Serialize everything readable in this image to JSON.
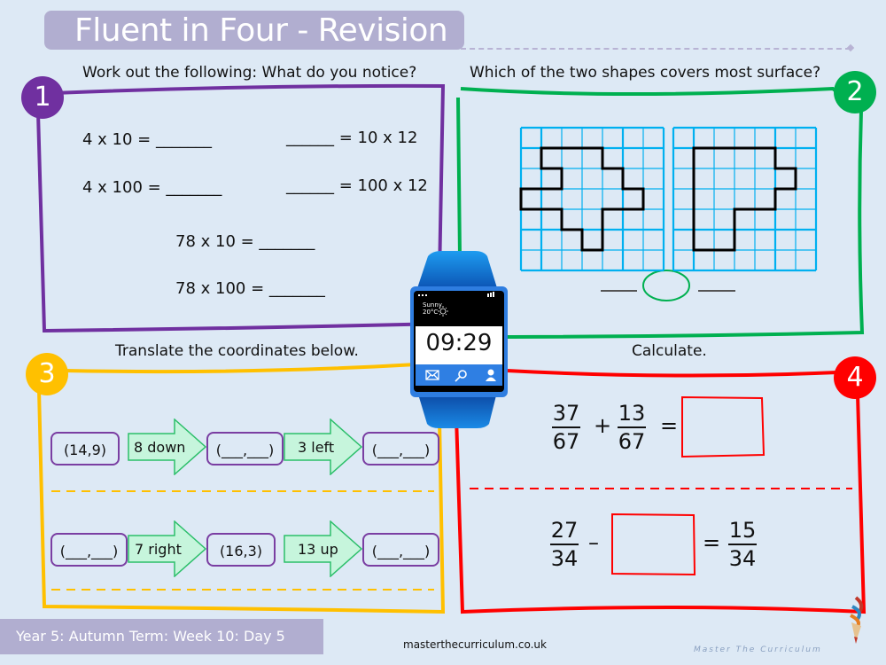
{
  "header": {
    "title": "Fluent in Four - Revision"
  },
  "footer": {
    "label": "Year 5: Autumn Term: Week 10: Day 5",
    "website": "masterthecurriculum.co.uk",
    "brand": "Master The Curriculum"
  },
  "colors": {
    "q1": "#7030a0",
    "q2": "#00b050",
    "q3": "#ffc000",
    "q4": "#ff0000",
    "grid": "#00b0f0",
    "arrow_fill": "#c6f5dc",
    "arrow_stroke": "#2cbf6a",
    "coord_border": "#7a3ea2",
    "banner": "#b1aed0"
  },
  "q1": {
    "number": "1",
    "prompt": "Work out the following: What do you notice?",
    "equations": [
      "4 x 10 = _______",
      "4 x 100 = _______",
      "______ = 10 x 12",
      "______ = 100 x 12",
      "78 x 10 = _______",
      "78 x 100 = _______"
    ]
  },
  "q2": {
    "number": "2",
    "prompt": "Which of the two shapes covers most surface?",
    "grid_size": 7,
    "shape_a": [
      [
        1,
        1
      ],
      [
        4,
        1
      ],
      [
        4,
        2
      ],
      [
        5,
        2
      ],
      [
        5,
        3
      ],
      [
        6,
        3
      ],
      [
        6,
        4
      ],
      [
        4,
        4
      ],
      [
        4,
        6
      ],
      [
        3,
        6
      ],
      [
        3,
        5
      ],
      [
        2,
        5
      ],
      [
        2,
        4
      ],
      [
        0,
        4
      ],
      [
        0,
        3
      ],
      [
        2,
        3
      ],
      [
        2,
        2
      ],
      [
        1,
        2
      ]
    ],
    "shape_b": [
      [
        1,
        1
      ],
      [
        5,
        1
      ],
      [
        5,
        2
      ],
      [
        6,
        2
      ],
      [
        6,
        3
      ],
      [
        5,
        3
      ],
      [
        5,
        4
      ],
      [
        3,
        4
      ],
      [
        3,
        6
      ],
      [
        1,
        6
      ]
    ],
    "blank_left": "____",
    "blank_right": "____"
  },
  "q3": {
    "number": "3",
    "prompt": "Translate the coordinates below.",
    "rows": [
      {
        "start": "(14,9)",
        "move1": "8 down",
        "mid": "(___,___)",
        "move2": "3 left",
        "end": "(___,___)"
      },
      {
        "start": "(___,___)",
        "move1": "7 right",
        "mid": "(16,3)",
        "move2": "13 up",
        "end": "(___,___)"
      }
    ]
  },
  "q4": {
    "number": "4",
    "prompt": "Calculate.",
    "eq1": {
      "a_num": "37",
      "a_den": "67",
      "op": "+",
      "b_num": "13",
      "b_den": "67",
      "eq": "="
    },
    "eq2": {
      "a_num": "27",
      "a_den": "34",
      "op": "–",
      "eq": "=",
      "r_num": "15",
      "r_den": "34"
    }
  },
  "watch": {
    "time": "09:29",
    "weather": "Sunny",
    "temp": "20°C"
  }
}
